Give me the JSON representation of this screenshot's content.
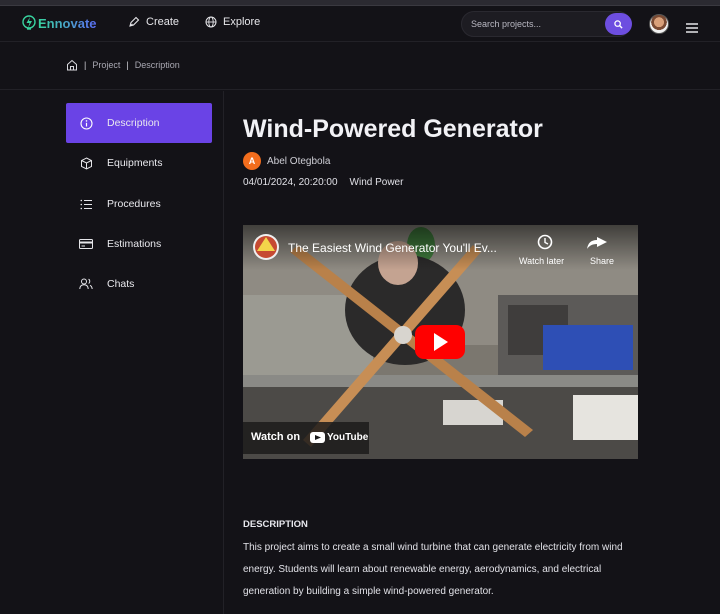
{
  "brand": {
    "name": "Ennovate"
  },
  "nav": {
    "create_label": "Create",
    "explore_label": "Explore"
  },
  "search": {
    "placeholder": "Search projects..."
  },
  "breadcrumb": {
    "items": [
      "Project",
      "Description"
    ]
  },
  "sidebar": {
    "items": [
      {
        "label": "Description",
        "icon": "info-icon",
        "active": true
      },
      {
        "label": "Equipments",
        "icon": "box-icon"
      },
      {
        "label": "Procedures",
        "icon": "list-icon"
      },
      {
        "label": "Estimations",
        "icon": "card-icon"
      },
      {
        "label": "Chats",
        "icon": "users-icon"
      }
    ]
  },
  "project": {
    "title": "Wind-Powered Generator",
    "author_initial": "A",
    "author": "Abel Otegbola",
    "date": "04/01/2024, 20:20:00",
    "category": "Wind Power"
  },
  "video": {
    "title": "The Easiest Wind Generator You'll Ev...",
    "watch_later": "Watch later",
    "share": "Share",
    "watch_on": "Watch on",
    "platform": "YouTube"
  },
  "description": {
    "heading": "DESCRIPTION",
    "text": "This project aims to create a small wind turbine that can generate electricity from wind energy. Students will learn about renewable energy, aerodynamics, and electrical generation by building a simple wind-powered generator."
  },
  "colors": {
    "accent": "#6a43e6",
    "background": "#131217",
    "author_badge": "#f26d1d",
    "play": "#ff0000"
  }
}
